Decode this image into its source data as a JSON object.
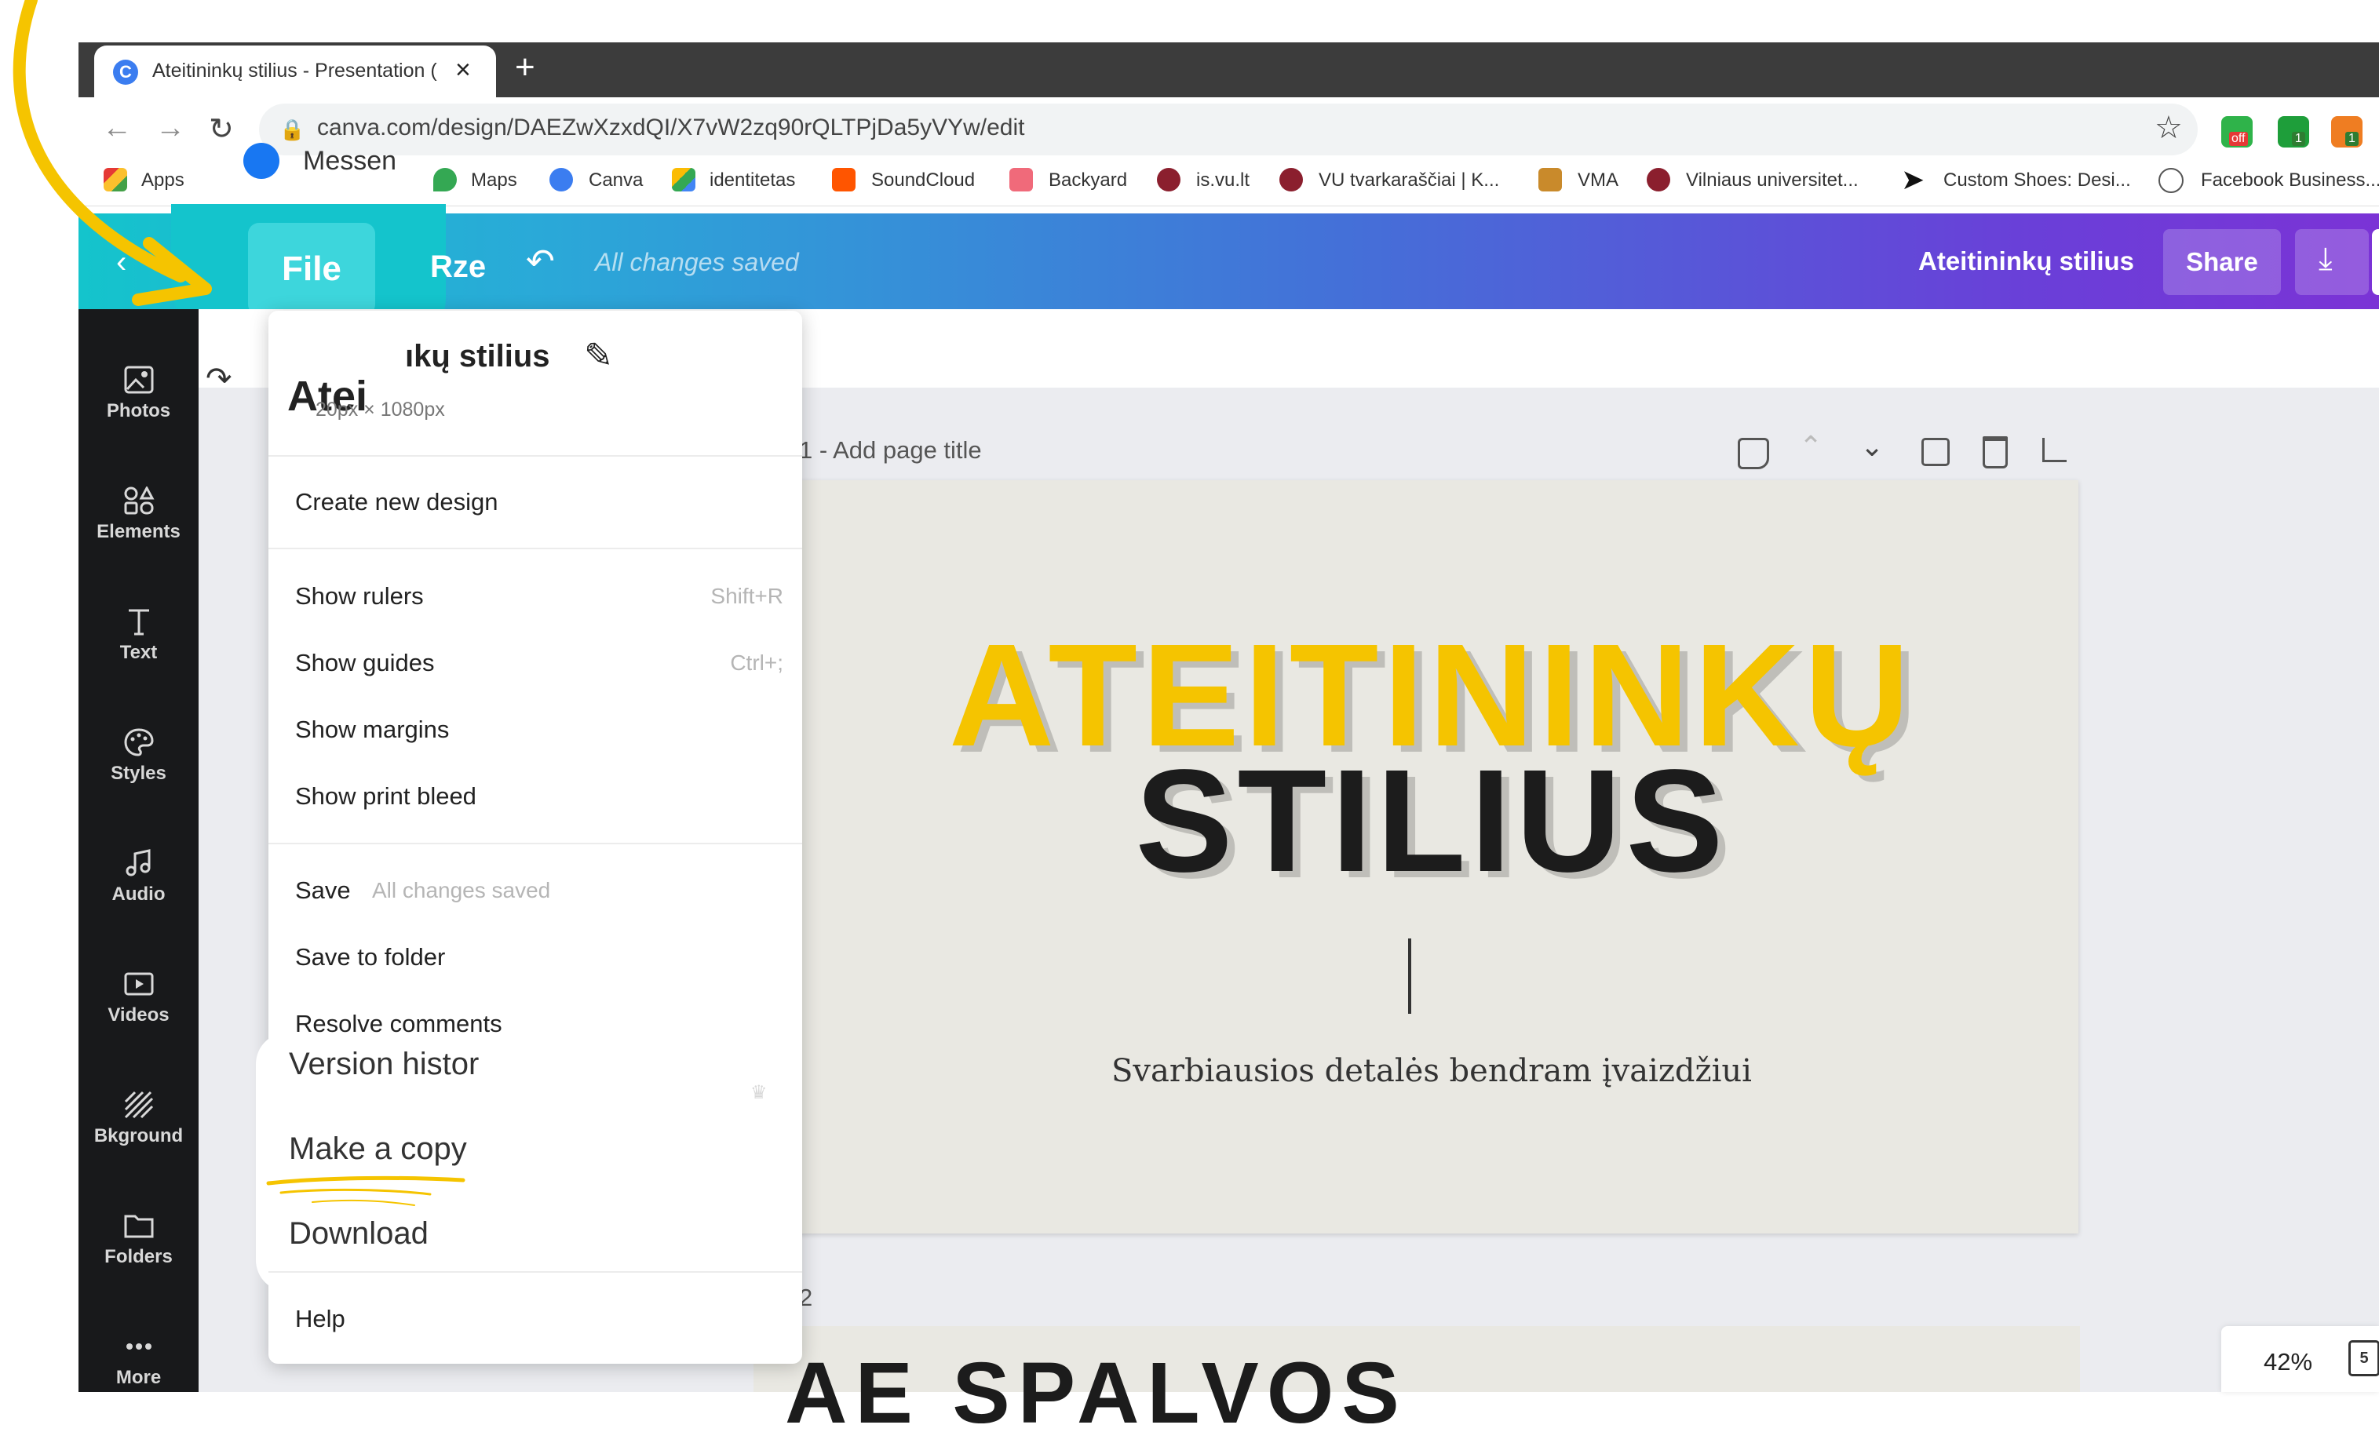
{
  "browser": {
    "tab_title": "Ateitininkų stilius - Presentation (",
    "tab_favicon": "C",
    "url": "canva.com/design/DAEZwXzxdQI/X7vW2zq90rQLTPjDa5yVYw/edit",
    "new_tab": "+",
    "close_tab": "×",
    "ext_badge_off": "off",
    "ext_badge_1": "1",
    "ext_badge_2": "1",
    "bookmarks": [
      "Apps",
      "Messen",
      "Maps",
      "Canva",
      "identitetas",
      "SoundCloud",
      "Backyard",
      "is.vu.lt",
      "VU tvarkaraščiai | K...",
      "VMA",
      "Vilniaus universitet...",
      "Custom Shoes: Desi...",
      "Facebook Business..."
    ]
  },
  "header": {
    "file": "File",
    "resize": "Rze",
    "status": "All changes saved",
    "design_title": "Ateitininkų stilius",
    "share": "Share"
  },
  "sidebar": {
    "items": [
      {
        "label": "Photos"
      },
      {
        "label": "Elements"
      },
      {
        "label": "Text"
      },
      {
        "label": "Styles"
      },
      {
        "label": "Audio"
      },
      {
        "label": "Videos"
      },
      {
        "label": "Bkground"
      },
      {
        "label": "Folders"
      },
      {
        "label": "More"
      }
    ]
  },
  "menu": {
    "design_name": "Ateitininkų stilius",
    "design_name_partial": "Atei",
    "design_name_partial2": "ıkų stilius",
    "dimensions": "1920px × 1080px",
    "dimensions_partial": "20px × 1080px",
    "create_new_design": "Create new design",
    "show_rulers": "Show rulers",
    "show_rulers_shortcut": "Shift+R",
    "show_guides": "Show guides",
    "show_guides_shortcut": "Ctrl+;",
    "show_margins": "Show margins",
    "show_print_bleed": "Show print bleed",
    "save": "Save",
    "save_status": "All changes saved",
    "save_to_folder": "Save to folder",
    "resolve_comments": "Resolve comments",
    "version_history": "Version histor",
    "make_a_copy": "Make a copy",
    "download": "Download",
    "help": "Help"
  },
  "canvas": {
    "page1_label": "1 - Add page title",
    "headline_line1": "ATEITININKŲ",
    "headline_line2": "STILIUS",
    "subtitle": "Svarbiausios detalės bendram įvaizdžiui",
    "page2_label": "2",
    "page2_headline": "AE SPALVOS"
  },
  "footer": {
    "zoom": "42%",
    "page_count": "5"
  },
  "colors": {
    "highlight_yellow": "#f5c400",
    "header_start": "#14c4cc",
    "header_end": "#7b33d6",
    "sidebar_bg": "#18191b"
  }
}
